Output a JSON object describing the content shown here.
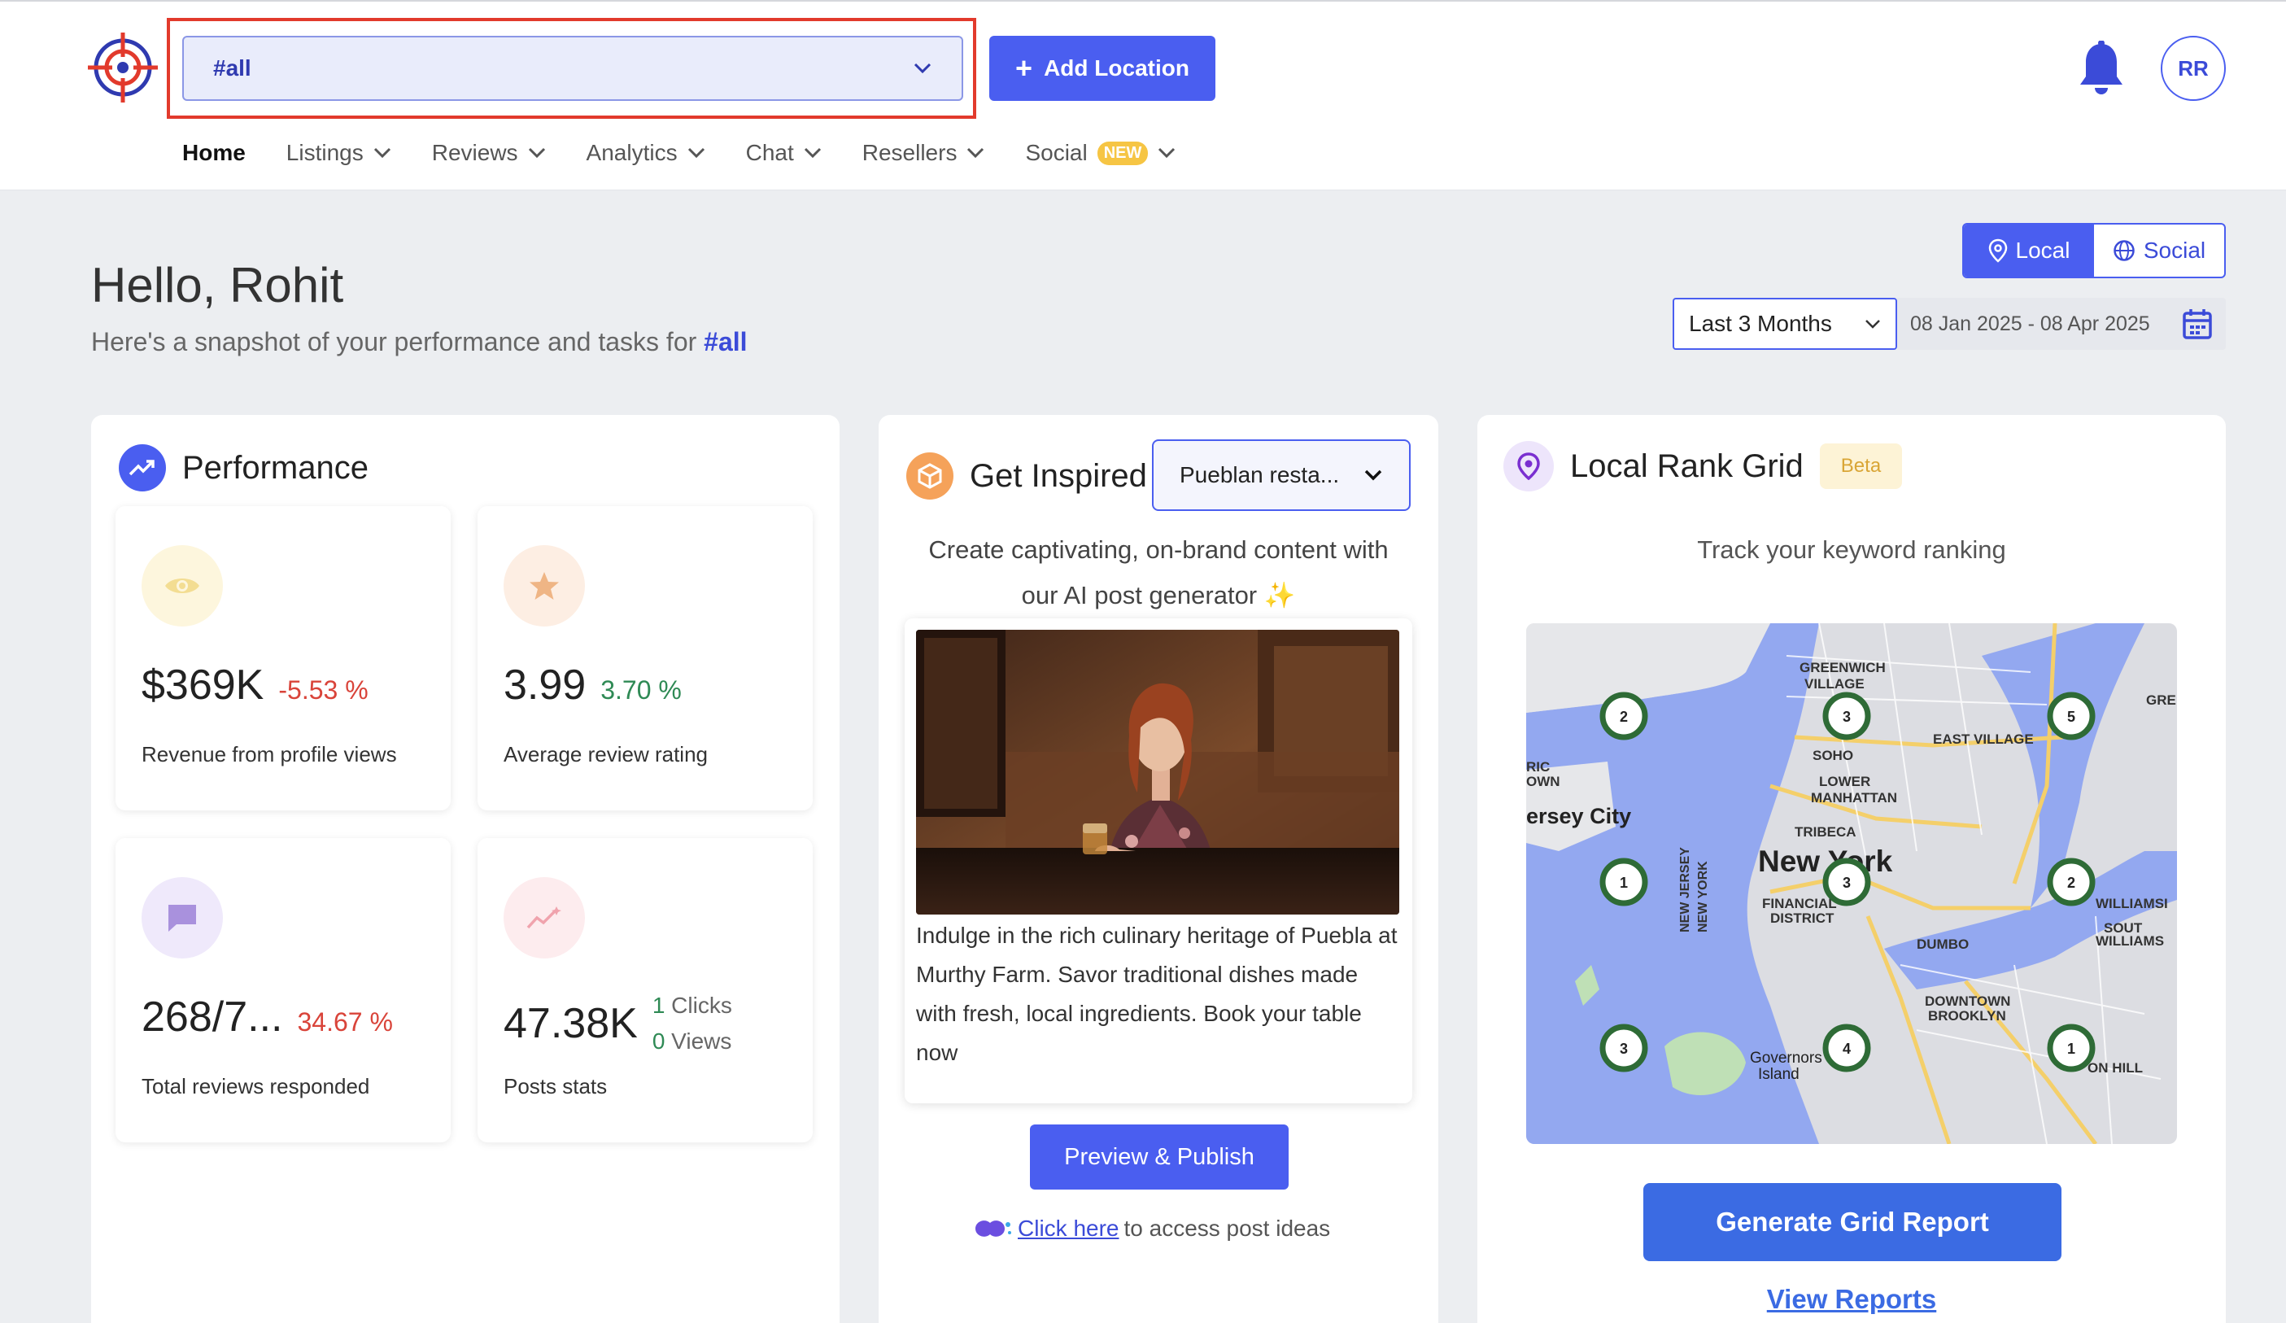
{
  "header": {
    "location_selector": "#all",
    "add_location_label": "Add Location",
    "avatar_initials": "RR",
    "nav": [
      {
        "label": "Home",
        "active": true
      },
      {
        "label": "Listings"
      },
      {
        "label": "Reviews"
      },
      {
        "label": "Analytics"
      },
      {
        "label": "Chat"
      },
      {
        "label": "Resellers"
      },
      {
        "label": "Social",
        "badge": "NEW"
      }
    ]
  },
  "mode_toggle": {
    "local": "Local",
    "social": "Social",
    "selected": "Local"
  },
  "greeting": {
    "title": "Hello, Rohit",
    "subtitle": "Here's a snapshot of your performance and tasks for",
    "tag": "#all"
  },
  "date_filter": {
    "range": "Last 3 Months",
    "dates": "08 Jan 2025 - 08 Apr 2025"
  },
  "performance": {
    "title": "Performance",
    "stats": [
      {
        "value": "$369K",
        "change": "-5.53 %",
        "label": "Revenue from profile views",
        "icon": "eye-icon"
      },
      {
        "value": "3.99",
        "change": "3.70 %",
        "label": "Average review rating",
        "icon": "star-icon"
      },
      {
        "value": "268/7...",
        "change": "34.67 %",
        "label": "Total reviews responded",
        "icon": "chat-icon"
      },
      {
        "value": "47.38K",
        "clicks_n": "1",
        "clicks_l": "Clicks",
        "views_n": "0",
        "views_l": "Views",
        "label": "Posts stats",
        "icon": "sparkline-icon"
      }
    ]
  },
  "inspired": {
    "title": "Get Inspired",
    "business": "Pueblan resta...",
    "desc_line1": "Create captivating, on-brand content with",
    "desc_line2": "our AI post generator",
    "post_text": "Indulge in the rich culinary heritage of Puebla at Murthy Farm. Savor traditional dishes made with fresh, local ingredients. Book your table now",
    "preview_label": "Preview & Publish",
    "ideas_link": "Click here",
    "ideas_text": "to access post ideas"
  },
  "rank_grid": {
    "title": "Local Rank Grid",
    "badge": "Beta",
    "desc": "Track your keyword ranking",
    "pins": [
      "2",
      "3",
      "5",
      "1",
      "3",
      "2",
      "3",
      "4",
      "1"
    ],
    "map_labels": {
      "greenwich": "GREENWICH",
      "village": "VILLAGE",
      "soho": "SOHO",
      "east_village": "EAST VILLAGE",
      "lower": "LOWER",
      "manhattan": "MANHATTAN",
      "tribeca": "TRIBECA",
      "jersey": "ersey City",
      "new_york": "New York",
      "financial": "FINANCIAL",
      "district": "DISTRICT",
      "dumbo": "DUMBO",
      "downtown": "DOWNTOWN",
      "brooklyn": "BROOKLYN",
      "governors": "Governors",
      "island": "Island",
      "williamsburg": "WILLIAMSI",
      "south_williams": "SOUT",
      "williams2": "WILLIAMS",
      "clinton_hill": "ON HILL",
      "gre": "GRE",
      "ric": "RIC",
      "own": "OWN",
      "nj": "NEW JERSEY",
      "ny": "NEW YORK"
    },
    "generate_label": "Generate Grid Report",
    "view_reports_label": "View Reports"
  }
}
